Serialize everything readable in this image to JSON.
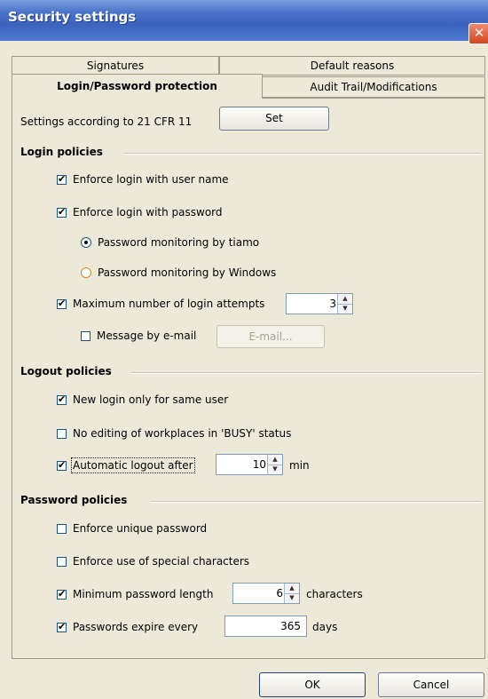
{
  "window": {
    "title": "Security settings",
    "close_label": "✕"
  },
  "tabs": {
    "row1": [
      "Signatures",
      "Default reasons"
    ],
    "row2": [
      "Login/Password protection",
      "Audit Trail/Modifications"
    ]
  },
  "cfr": {
    "label": "Settings according to 21 CFR 11",
    "button": "Set"
  },
  "login_policies": {
    "heading": "Login policies",
    "enforce_user": {
      "label": "Enforce login with user name",
      "checked": true
    },
    "enforce_password": {
      "label": "Enforce login with password",
      "checked": true
    },
    "monitor_tiamo": {
      "label": "Password monitoring by tiamo",
      "selected": true
    },
    "monitor_windows": {
      "label": "Password monitoring by Windows",
      "selected": false
    },
    "max_attempts": {
      "label": "Maximum number of login attempts",
      "checked": true,
      "value": "3"
    },
    "message_email": {
      "label": "Message by e-mail",
      "checked": false,
      "button": "E-mail..."
    }
  },
  "logout_policies": {
    "heading": "Logout policies",
    "same_user": {
      "label": "New login only for same user",
      "checked": true
    },
    "no_editing": {
      "label": "No editing of workplaces in 'BUSY' status",
      "checked": false
    },
    "auto_logout": {
      "label": "Automatic logout after",
      "checked": true,
      "value": "10",
      "unit": "min"
    }
  },
  "password_policies": {
    "heading": "Password policies",
    "unique": {
      "label": "Enforce unique password",
      "checked": false
    },
    "special_chars": {
      "label": "Enforce use of special characters",
      "checked": false
    },
    "min_length": {
      "label": "Minimum password length",
      "checked": true,
      "value": "6",
      "unit": "characters"
    },
    "expire": {
      "label": "Passwords expire every",
      "checked": true,
      "value": "365",
      "unit": "days"
    }
  },
  "footer": {
    "ok": "OK",
    "cancel": "Cancel"
  },
  "colors": {
    "titlebar": "#3b63bd",
    "close": "#d2451f",
    "background": "#ece9d8"
  }
}
